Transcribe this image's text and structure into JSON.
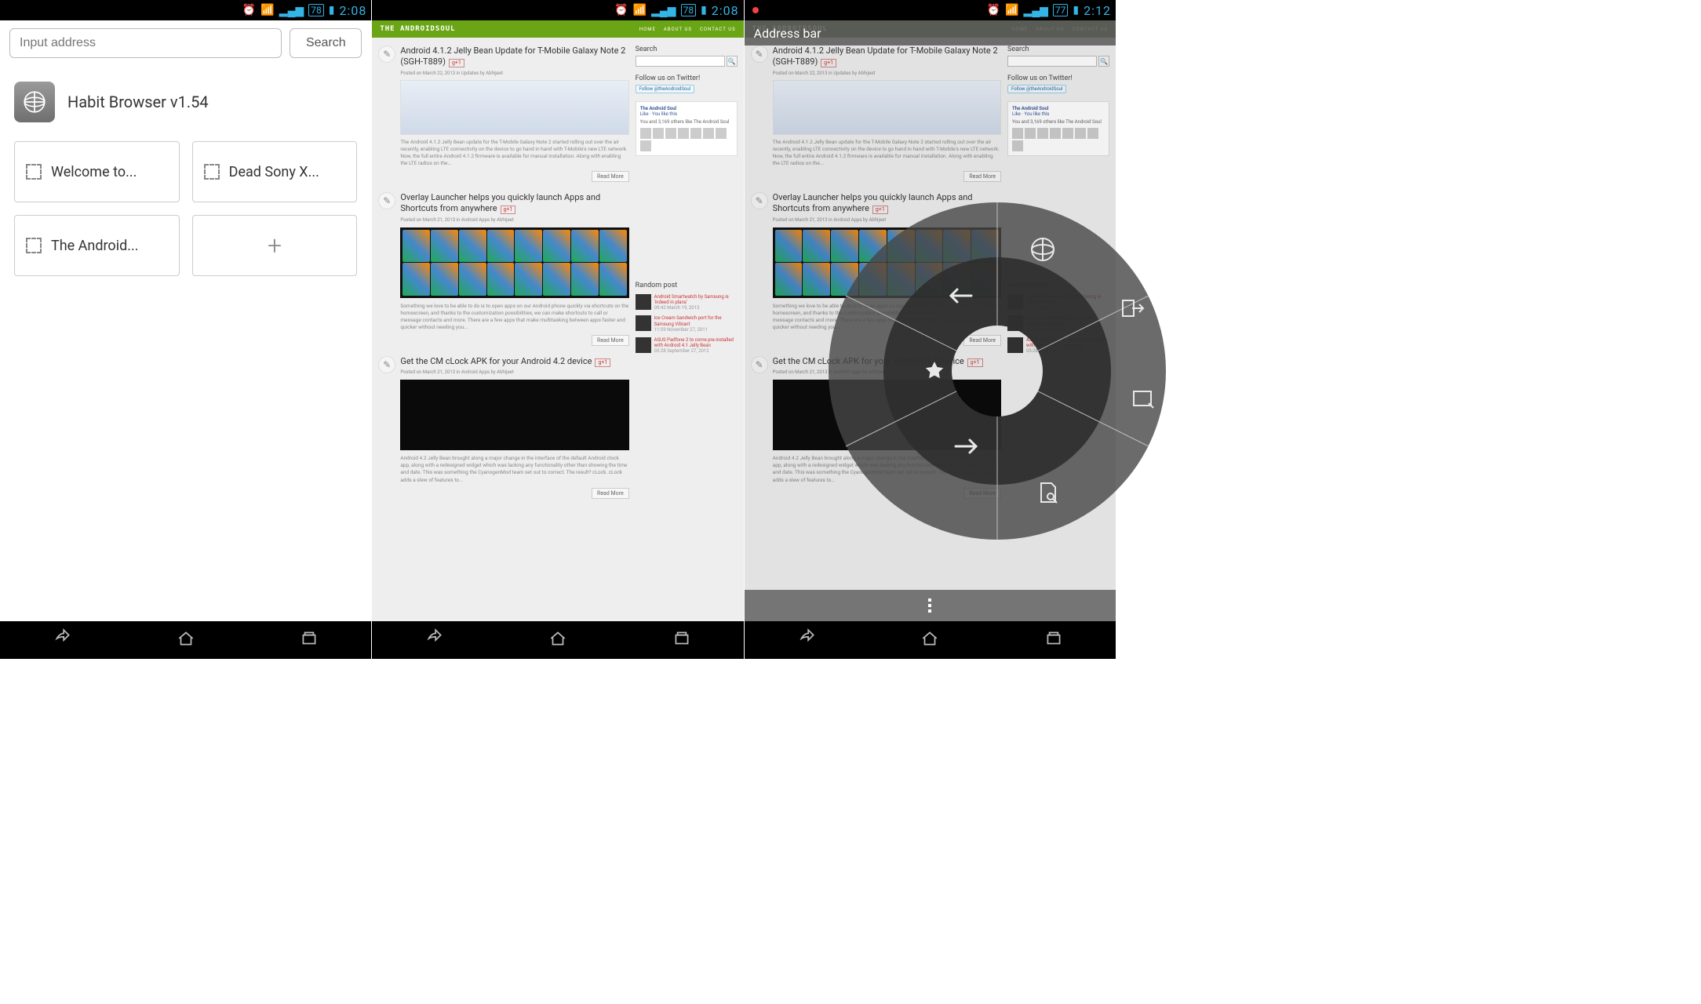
{
  "status": {
    "time1": "2:08",
    "time2": "2:08",
    "time3": "2:12",
    "batt1": "78",
    "batt2": "78",
    "batt3": "77"
  },
  "pane1": {
    "input_placeholder": "Input address",
    "search_label": "Search",
    "title": "Habit Browser v1.54",
    "tiles": [
      "Welcome to...",
      "Dead Sony X...",
      "The Android..."
    ]
  },
  "site": {
    "brand": "THE ANDROIDSOUL",
    "nav": [
      "HOME",
      "ABOUT US",
      "CONTACT US"
    ],
    "articles": [
      {
        "title": "Android 4.1.2 Jelly Bean Update for T-Mobile Galaxy Note 2 (SGH-T889)",
        "meta": "Posted on March 22, 2013 in Updates by Abhijeet",
        "excerpt": "The Android 4.1.2 Jelly Bean update for the T-Mobile Galaxy Note 2 started rolling out over the air recently, enabling LTE connectivity on the device to go hand in hand with T-Mobile's new LTE network. Now, the full entire Android 4.1.2 firmware is available for manual installation. Along with enabling the LTE radios on the...",
        "readmore": "Read More"
      },
      {
        "title": "Overlay Launcher helps you quickly launch Apps and Shortcuts from anywhere",
        "meta": "Posted on March 21, 2013 in Android Apps by Abhijeet",
        "excerpt": "Something we love to be able to do is to open apps on our Android phone quickly via shortcuts on the homescreen, and thanks to the customization possibilities, we can make shortcuts to call or message contacts and more. There are a few apps that make multitasking between apps faster and quicker without needing you...",
        "readmore": "Read More"
      },
      {
        "title": "Get the CM cLock APK for your Android 4.2 device",
        "meta": "Posted on March 21, 2013 in Android Apps by Abhijeet",
        "excerpt": "Android 4.2 Jelly Bean brought along a major change in the interface of the default Android clock app, along with a redesigned widget which was lacking any functionality other than showing the time and date. This was something the CyanogenMod team set out to correct. The result? cLock. cLock adds a slew of features to...",
        "readmore": "Read More"
      }
    ],
    "sidebar": {
      "search": "Search",
      "twitter_title": "Follow us on Twitter!",
      "twitter_btn": "Follow @theAndroidSoul",
      "fb_title": "The Android Soul",
      "fb_like": "Like · You like this",
      "fb_text": "You and 3,169 others like The Android Soul",
      "random_title": "Random post",
      "random": [
        {
          "t": "Android Smartwatch by Samsung is 'indeed in plans'",
          "d": "09:42 March 19, 2013"
        },
        {
          "t": "Ice Cream Sandwich port for the Samsung Vibrant",
          "d": "11:59 November 27, 2011"
        },
        {
          "t": "ASUS Padfone 2 to come pre-installed with Android 4.1 Jelly Bean",
          "d": "05:28 September 27, 2012"
        }
      ]
    }
  },
  "pane3": {
    "addr_bar": "Address bar"
  }
}
